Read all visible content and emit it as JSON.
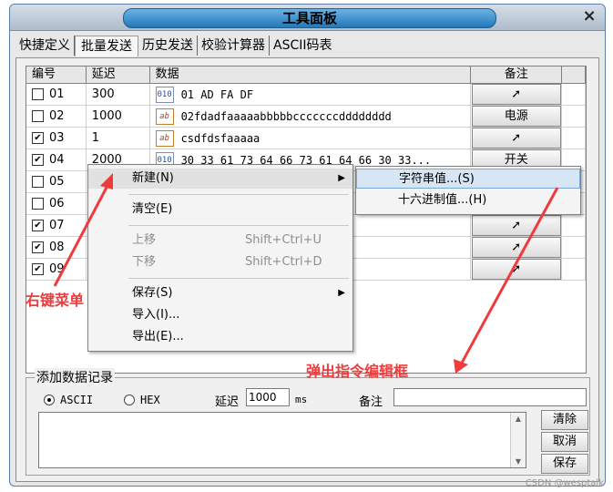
{
  "window": {
    "title": "工具面板",
    "close": "×"
  },
  "tabs": [
    {
      "label": "快捷定义"
    },
    {
      "label": "批量发送"
    },
    {
      "label": "历史发送"
    },
    {
      "label": "校验计算器"
    },
    {
      "label": "ASCII码表"
    }
  ],
  "grid": {
    "headers": [
      "编号",
      "延迟",
      "数据",
      "备注"
    ],
    "rows": [
      {
        "num": "01",
        "checked": false,
        "delay": "300",
        "type": "hex",
        "data": "01 AD FA DF",
        "note": "➚"
      },
      {
        "num": "02",
        "checked": false,
        "delay": "1000",
        "type": "ascii",
        "data": "02fdadfaaaaabbbbbcccccccdddddddd",
        "note": "电源"
      },
      {
        "num": "03",
        "checked": true,
        "delay": "1",
        "type": "ascii",
        "data": "csdfdsfaaaaa",
        "note": "➚"
      },
      {
        "num": "04",
        "checked": true,
        "delay": "2000",
        "type": "hex",
        "data": "30 33 61 73 64 66 73 61 64 66 30 33...",
        "note": "开关"
      },
      {
        "num": "05",
        "checked": false,
        "delay": "",
        "type": "",
        "data": "",
        "note": ""
      },
      {
        "num": "06",
        "checked": false,
        "delay": "",
        "type": "",
        "data": "",
        "note": ""
      },
      {
        "num": "07",
        "checked": true,
        "delay": "",
        "type": "",
        "data": "",
        "note": "➚"
      },
      {
        "num": "08",
        "checked": true,
        "delay": "",
        "type": "",
        "data": "",
        "note": "➚"
      },
      {
        "num": "09",
        "checked": true,
        "delay": "",
        "type": "",
        "data": "",
        "note": "➚"
      }
    ]
  },
  "context_menu": {
    "items": [
      {
        "label": "新建(N)",
        "shortcut": "",
        "arrow": "▶",
        "disabled": false
      },
      {
        "label": "清空(E)",
        "shortcut": "",
        "arrow": "",
        "disabled": false
      },
      {
        "label": "上移",
        "shortcut": "Shift+Ctrl+U",
        "arrow": "",
        "disabled": true
      },
      {
        "label": "下移",
        "shortcut": "Shift+Ctrl+D",
        "arrow": "",
        "disabled": true
      },
      {
        "label": "保存(S)",
        "shortcut": "",
        "arrow": "▶",
        "disabled": false
      },
      {
        "label": "导入(I)...",
        "shortcut": "",
        "arrow": "",
        "disabled": false
      },
      {
        "label": "导出(E)...",
        "shortcut": "",
        "arrow": "",
        "disabled": false
      }
    ],
    "submenu": [
      {
        "label": "字符串值...(S)"
      },
      {
        "label": "十六进制值...(H)"
      }
    ]
  },
  "add_record": {
    "group_title": "添加数据记录",
    "radio_ascii": "ASCII",
    "radio_hex": "HEX",
    "delay_label": "延迟",
    "delay_value": "1000",
    "delay_unit": "ms",
    "note_label": "备注",
    "note_value": "",
    "buttons": {
      "clear": "清除",
      "cancel": "取消",
      "save": "保存"
    }
  },
  "annotations": {
    "right_click_menu": "右键菜单",
    "popup_editor": "弹出指令编辑框"
  },
  "watermark": "CSDN @wesptalk",
  "colors": {
    "annotation": "#ef3b3b",
    "title_pill": "#2378b9"
  }
}
